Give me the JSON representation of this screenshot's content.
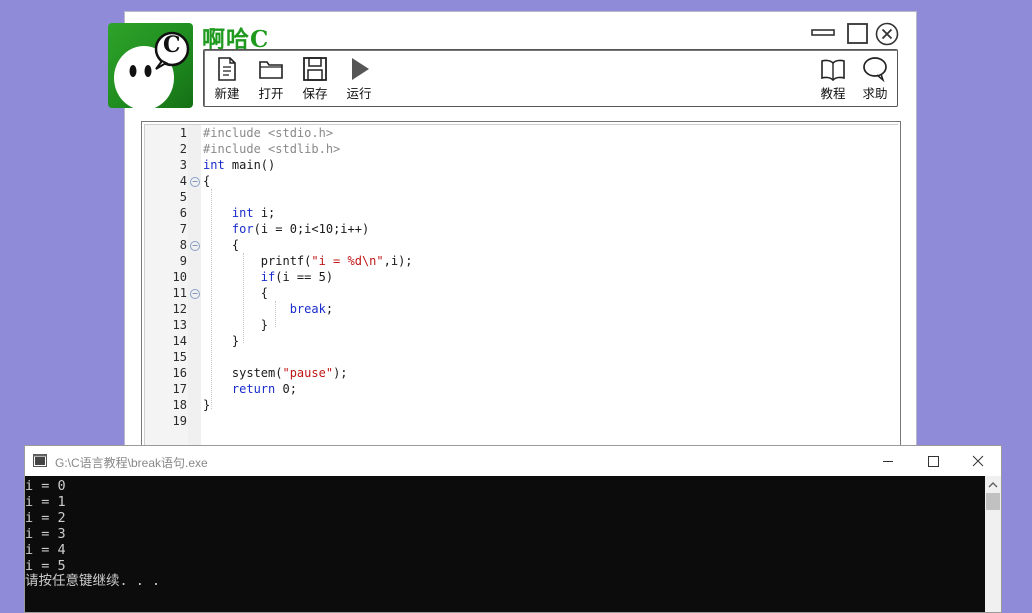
{
  "app": {
    "title": "啊哈C",
    "logo_letter": "C"
  },
  "toolbar": {
    "new_label": "新建",
    "open_label": "打开",
    "save_label": "保存",
    "run_label": "运行",
    "tutorial_label": "教程",
    "help_label": "求助"
  },
  "editor": {
    "line_numbers": [
      "1",
      "2",
      "3",
      "4",
      "5",
      "6",
      "7",
      "8",
      "9",
      "10",
      "11",
      "12",
      "13",
      "14",
      "15",
      "16",
      "17",
      "18",
      "19"
    ]
  },
  "console": {
    "title": "G:\\C语言教程\\break语句.exe",
    "output": [
      "i = 0",
      "i = 1",
      "i = 2",
      "i = 3",
      "i = 4",
      "i = 5",
      "请按任意键继续. . ."
    ]
  },
  "colors": {
    "desktop": "#8f8bd9",
    "brand_green": "#1f9a1f",
    "keyword": "#1a2ccc",
    "string": "#c01818",
    "preprocessor": "#8a8a8a",
    "console_bg": "#0c0c0c"
  }
}
